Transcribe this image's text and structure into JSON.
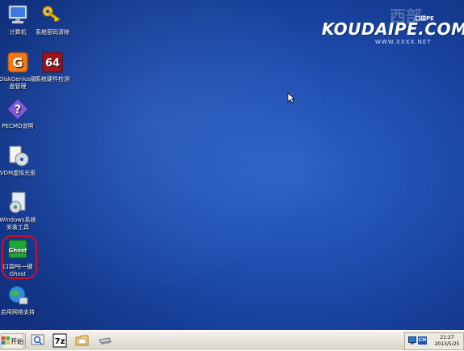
{
  "desktop_icons": [
    {
      "label": "计算机",
      "icon": "computer-icon"
    },
    {
      "label": "系统密码清除",
      "icon": "key-icon"
    },
    {
      "label": "DiskGenius磁盘管理",
      "icon": "diskgenius-icon"
    },
    {
      "label": "系统硬件检测",
      "icon": "hardware-64-icon"
    },
    {
      "label": "PECMD说明",
      "icon": "help-icon"
    },
    {
      "label": "VDM虚拟光驱",
      "icon": "virtual-drive-icon"
    },
    {
      "label": "Windows系统安装工具",
      "icon": "windows-setup-icon"
    },
    {
      "label": "口袋PE一键Ghost",
      "icon": "ghost-icon"
    },
    {
      "label": "启用网络支持",
      "icon": "network-icon"
    }
  ],
  "logo": {
    "main": "KOUDAIPE.COM",
    "badge": "口袋PE",
    "url": "WWW.XXXX.NET",
    "watermark": "西部"
  },
  "ghost_badge_text": "Ghost",
  "hw_badge_text": "64",
  "taskbar": {
    "start_label": "开始",
    "tray_time": "21:27",
    "tray_date": "2013/5/25",
    "quick_launch": [
      "magnifier-icon",
      "7zip-icon",
      "folder-icon",
      "drive-icon"
    ],
    "tray_icons": [
      "display-icon",
      "ch-icon"
    ],
    "tray_ch": "CH",
    "zip_text": "7z"
  },
  "colors": {
    "desktop": "#1f4fb0",
    "highlight_ring": "#d0102a",
    "taskbar": "#e6e3d8"
  }
}
